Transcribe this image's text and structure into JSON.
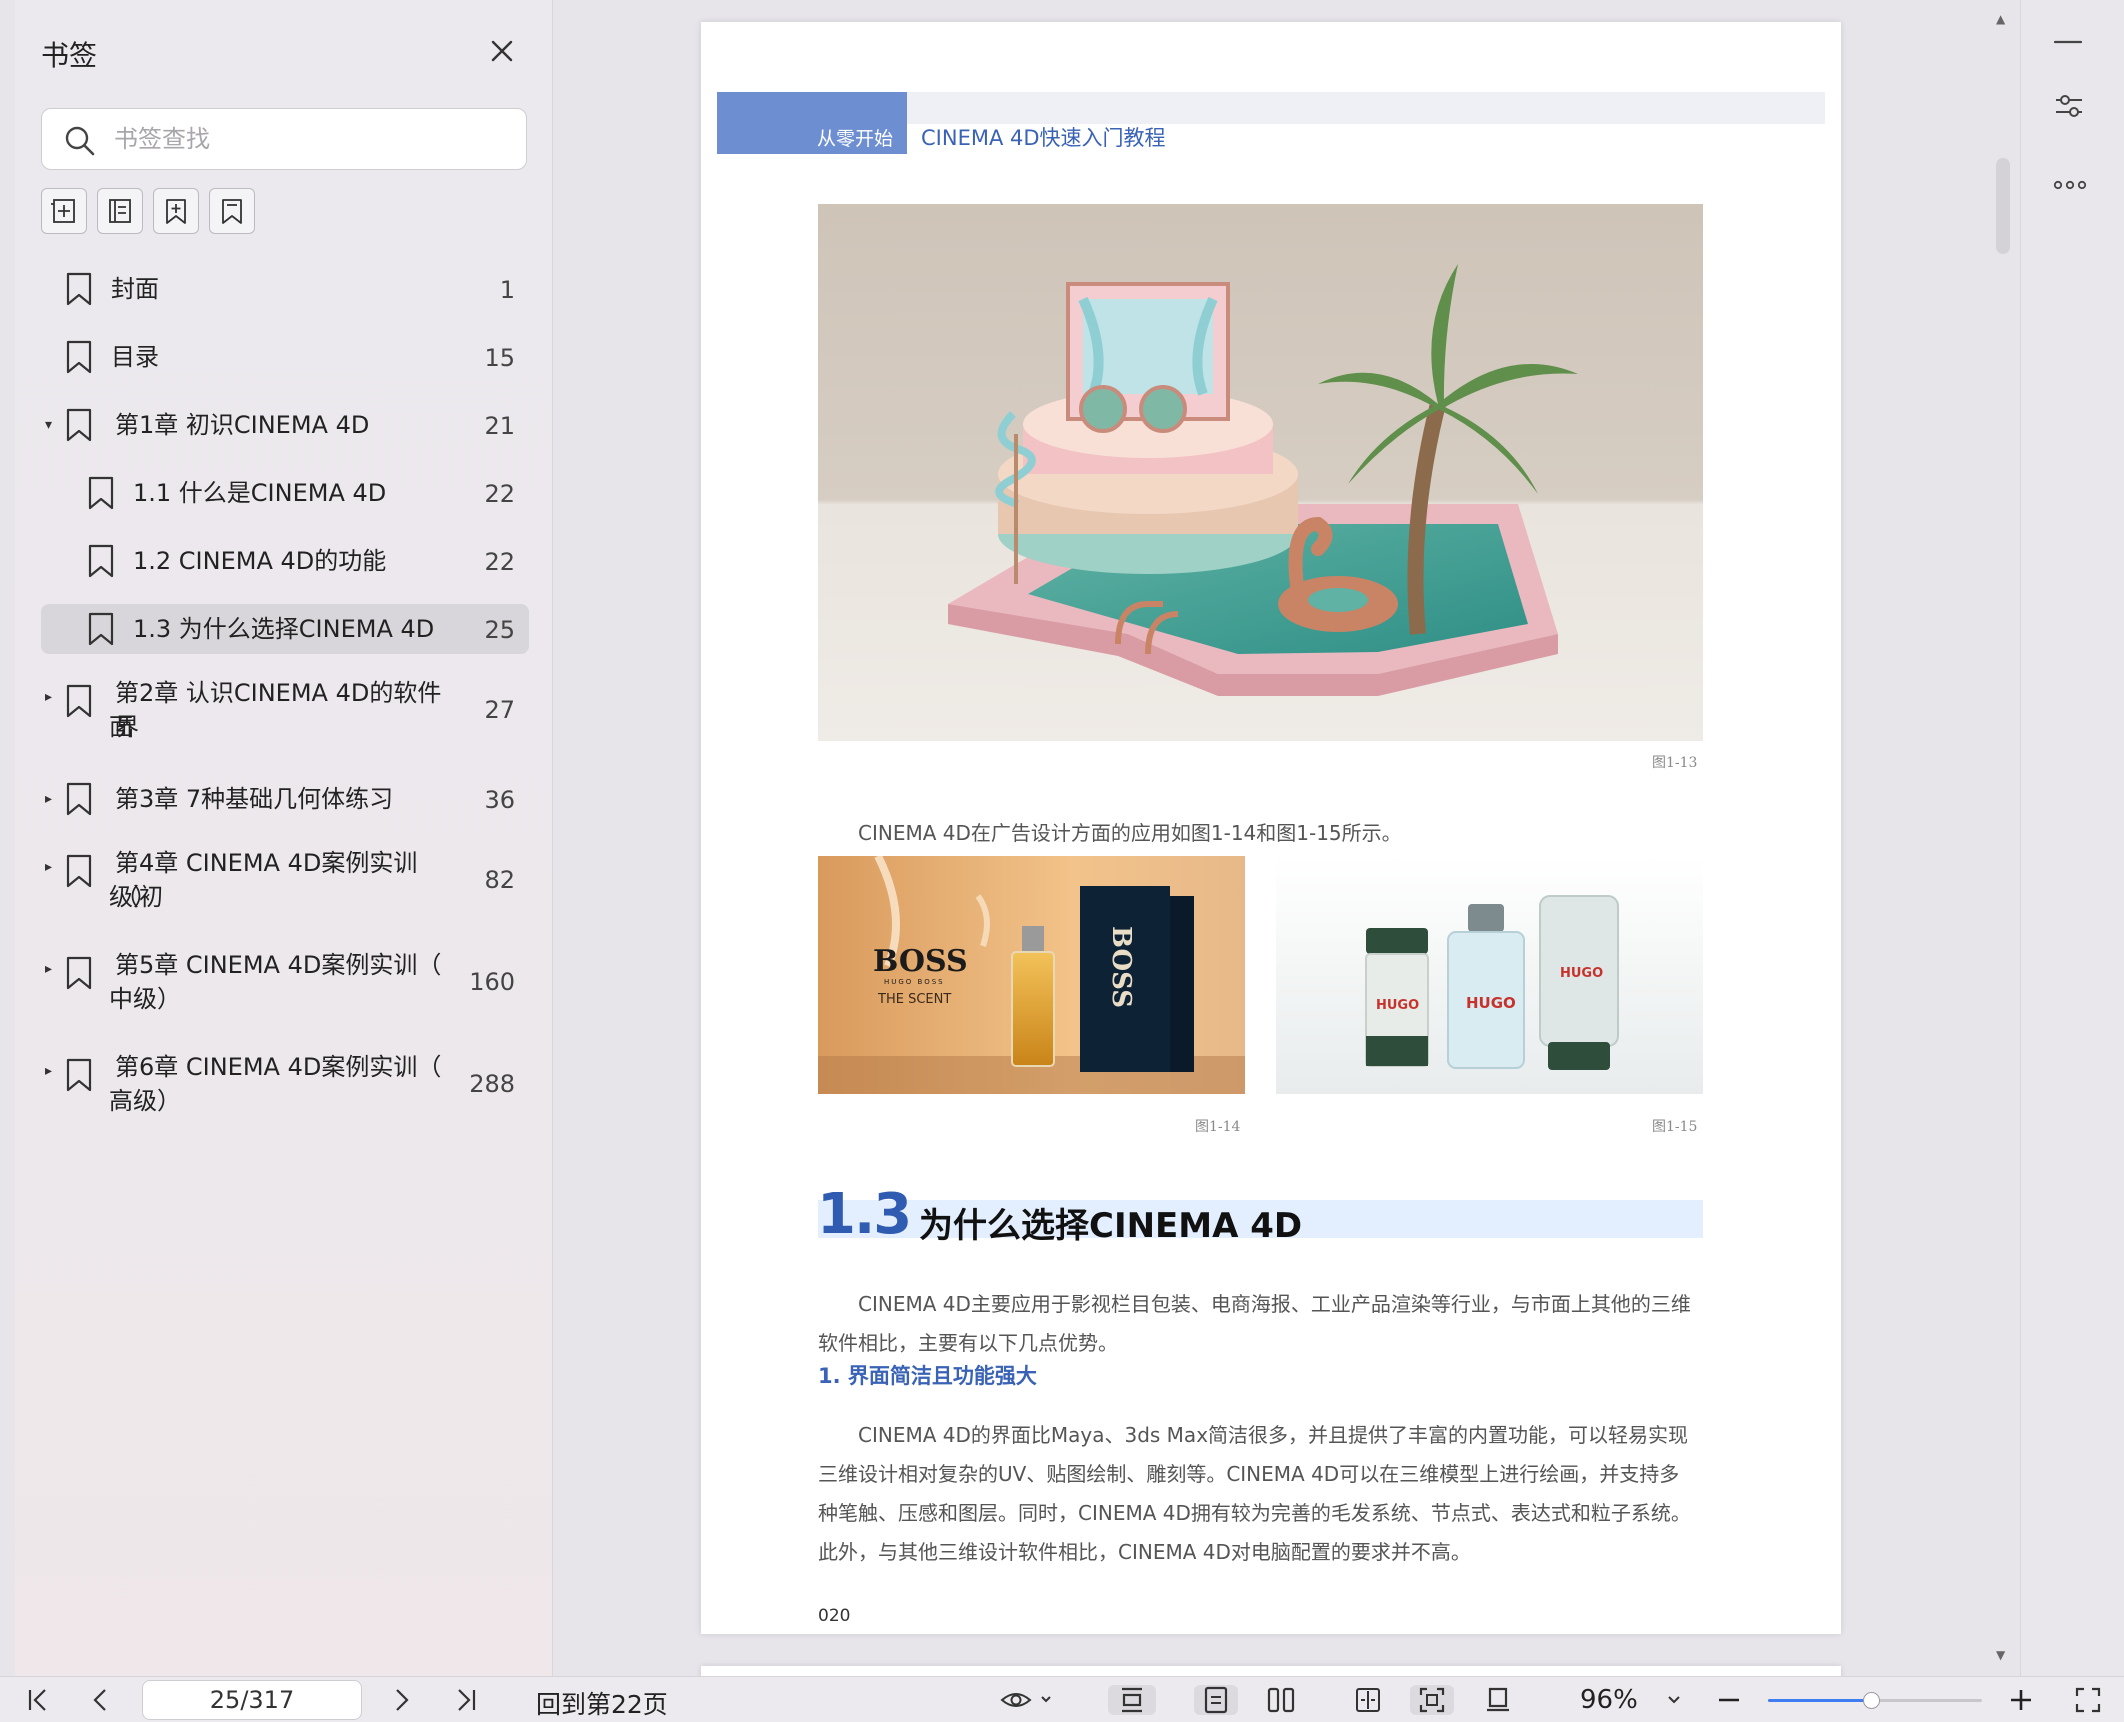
{
  "sidebar": {
    "title": "书签",
    "search_placeholder": "书签查找",
    "tools": [
      {
        "icon": "add-bookmark-icon"
      },
      {
        "icon": "add-sub-bookmark-icon"
      },
      {
        "icon": "add-bookmark-page-icon"
      },
      {
        "icon": "bookmark-icon"
      }
    ],
    "items": [
      {
        "label": "封面",
        "page": "1",
        "level": 0,
        "expandable": false,
        "active": false
      },
      {
        "label": "目录",
        "page": "15",
        "level": 0,
        "expandable": false,
        "active": false
      },
      {
        "label": "第1章 初识CINEMA 4D",
        "page": "21",
        "level": 0,
        "expandable": true,
        "expanded": true,
        "active": false
      },
      {
        "label": "1.1 什么是CINEMA 4D",
        "page": "22",
        "level": 1,
        "expandable": false,
        "active": false
      },
      {
        "label": "1.2 CINEMA 4D的功能",
        "page": "22",
        "level": 1,
        "expandable": false,
        "active": false
      },
      {
        "label": "1.3 为什么选择CINEMA 4D",
        "page": "25",
        "level": 1,
        "expandable": false,
        "active": true
      },
      {
        "label": "第2章 认识CINEMA 4D的软件界",
        "label2": "面",
        "page": "27",
        "level": 0,
        "expandable": true,
        "expanded": false,
        "active": false
      },
      {
        "label": "第3章 7种基础几何体练习",
        "page": "36",
        "level": 0,
        "expandable": true,
        "expanded": false,
        "active": false
      },
      {
        "label": "第4章 CINEMA 4D案例实训（初",
        "label2": "级）",
        "page": "82",
        "level": 0,
        "expandable": true,
        "expanded": false,
        "active": false
      },
      {
        "label": "第5章 CINEMA 4D案例实训（",
        "label2": "中级）",
        "page": "160",
        "level": 0,
        "expandable": true,
        "expanded": false,
        "active": false
      },
      {
        "label": "第6章 CINEMA 4D案例实训（",
        "label2": "高级）",
        "page": "288",
        "level": 0,
        "expandable": true,
        "expanded": false,
        "active": false
      }
    ]
  },
  "document": {
    "header_tab": "从零开始",
    "header_subtitle": "CINEMA 4D快速入门教程",
    "fig13_caption": "图1-13",
    "para_intro": "CINEMA 4D在广告设计方面的应用如图1-14和图1-15所示。",
    "fig14_caption": "图1-14",
    "fig15_caption": "图1-15",
    "fig14_brand": "BOSS",
    "fig14_brand_sub": "HUGO BOSS",
    "fig14_product": "THE SCENT",
    "fig15_brand": "HUGO",
    "section_number": "1.3",
    "section_title": "为什么选择CINEMA 4D",
    "para1_line1": "CINEMA 4D主要应用于影视栏目包装、电商海报、工业产品渲染等行业，与市面上其他的三维",
    "para1_line2": "软件相比，主要有以下几点优势。",
    "subhead": "1. 界面简洁且功能强大",
    "para2_line1": "CINEMA 4D的界面比Maya、3ds Max简洁很多，并且提供了丰富的内置功能，可以轻易实现",
    "para2_line2": "三维设计相对复杂的UV、贴图绘制、雕刻等。CINEMA 4D可以在三维模型上进行绘画，并支持多",
    "para2_line3": "种笔触、压感和图层。同时，CINEMA 4D拥有较为完善的毛发系统、节点式、表达式和粒子系统。",
    "para2_line4": "此外，与其他三维设计软件相比，CINEMA 4D对电脑配置的要求并不高。",
    "page_number": "020"
  },
  "right_rail": {
    "icons": [
      "minimize-icon",
      "filter-settings-icon",
      "more-icon"
    ]
  },
  "bottombar": {
    "page_value": "25/317",
    "goto_label": "回到第22页",
    "zoom": "96%",
    "zoom_fraction": 0.48
  },
  "colors": {
    "accent": "#3e7ef0",
    "header_tab": "#6d8fd2",
    "section_blue": "#2f5bb1",
    "selected_row": "#d8d6da"
  }
}
